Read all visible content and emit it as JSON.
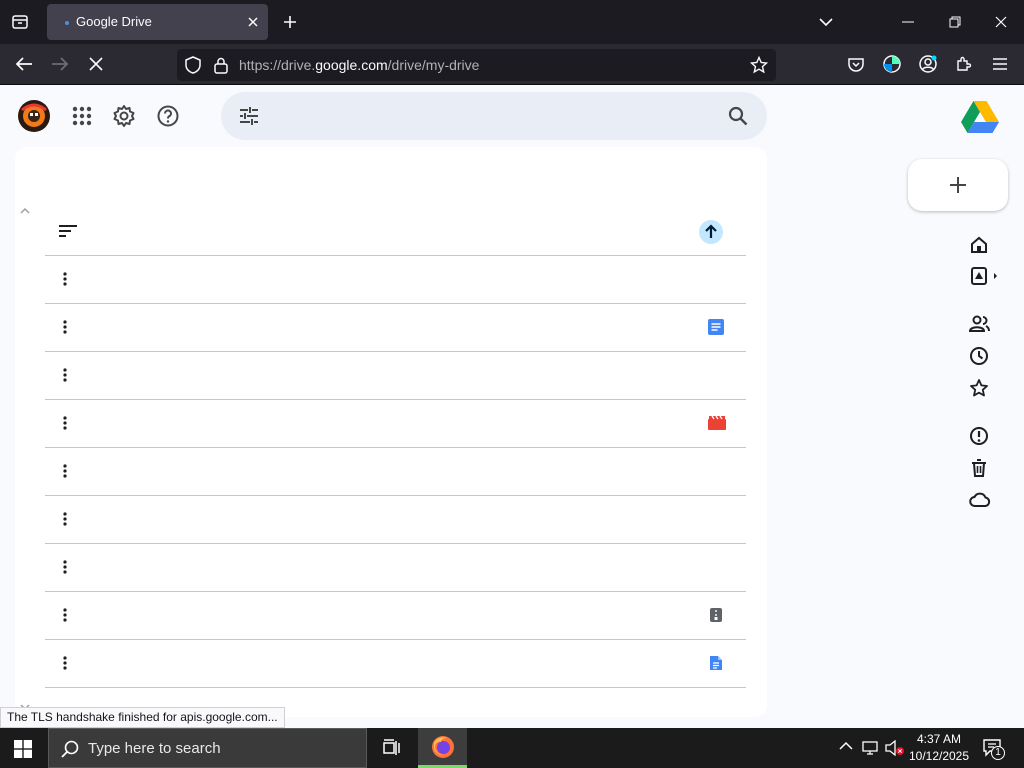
{
  "browser": {
    "tab": {
      "title": "Google Drive"
    },
    "url": {
      "prefix": "https://drive.",
      "host": "google.com",
      "path": "/drive/my-drive"
    },
    "status_text": "The TLS handshake finished for apis.google.com..."
  },
  "drive": {
    "list_rows": [
      {
        "file_icon": "none"
      },
      {
        "file_icon": "docs-icon"
      },
      {
        "file_icon": "none"
      },
      {
        "file_icon": "video-icon"
      },
      {
        "file_icon": "none"
      },
      {
        "file_icon": "none"
      },
      {
        "file_icon": "none"
      },
      {
        "file_icon": "zip-icon"
      },
      {
        "file_icon": "docs-icon"
      }
    ],
    "nav": [
      "home-icon",
      "my-drive-icon",
      "shared-icon",
      "recent-icon",
      "starred-icon",
      "spam-icon",
      "trash-icon",
      "storage-icon"
    ],
    "colors": {
      "docs": "#4285f4",
      "video": "#ea4335",
      "upload_badge": "#c2e7ff"
    }
  },
  "taskbar": {
    "search_placeholder": "Type here to search",
    "time": "4:37 AM",
    "date": "10/12/2025",
    "notification_count": "1"
  }
}
